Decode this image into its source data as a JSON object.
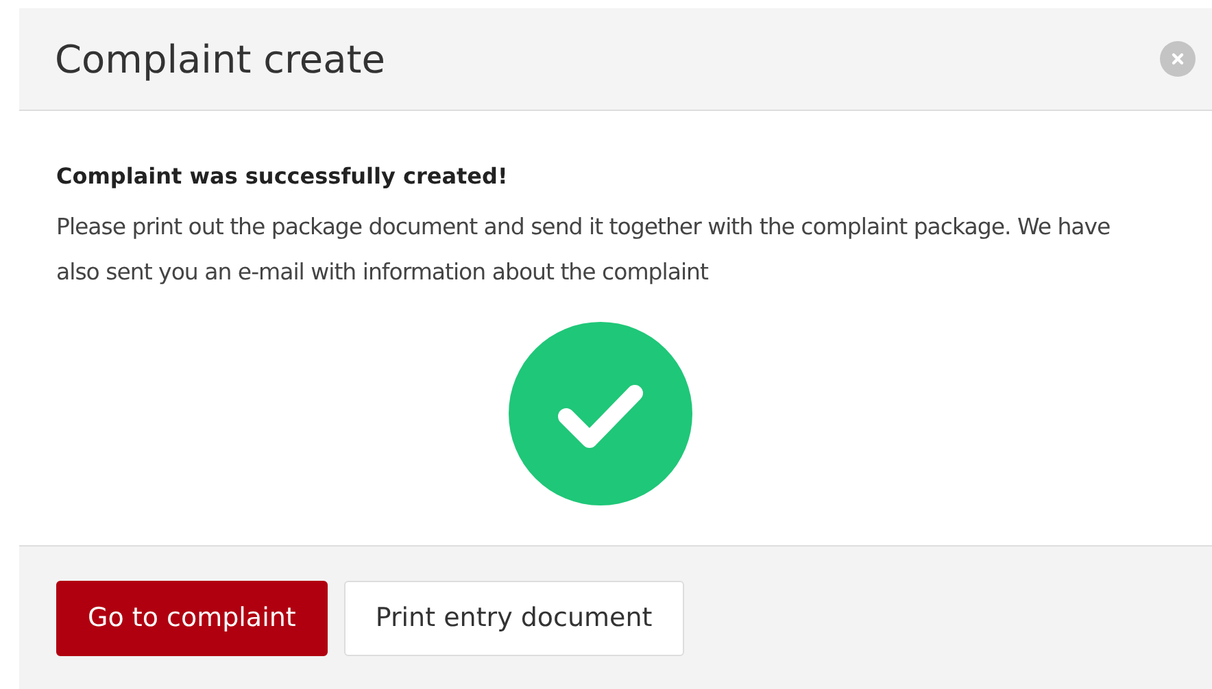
{
  "dialog": {
    "title": "Complaint create",
    "heading": "Complaint was successfully created!",
    "message": "Please print out the package document and send it together with the complaint package. We have also sent you an e-mail with information about the complaint",
    "buttons": [
      {
        "label": "Go to complaint",
        "kind": "primary"
      },
      {
        "label": "Print entry document",
        "kind": "secondary"
      }
    ]
  }
}
